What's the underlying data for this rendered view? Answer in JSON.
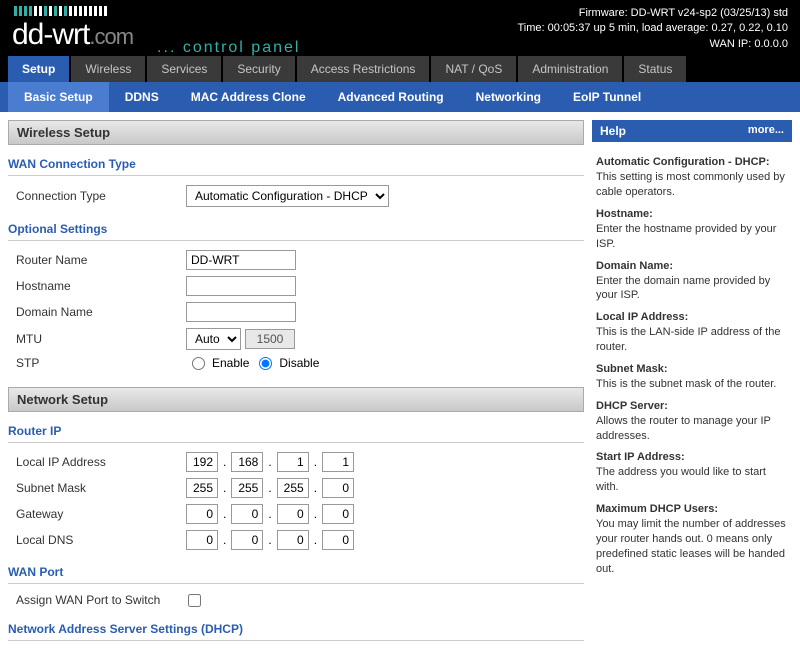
{
  "status": {
    "firmware": "Firmware: DD-WRT v24-sp2 (03/25/13) std",
    "time": "Time: 00:05:37 up 5 min, load average: 0.27, 0.22, 0.10",
    "wan": "WAN IP: 0.0.0.0"
  },
  "cp": "... control panel",
  "mainTabs": [
    "Setup",
    "Wireless",
    "Services",
    "Security",
    "Access Restrictions",
    "NAT / QoS",
    "Administration",
    "Status"
  ],
  "subTabs": [
    "Basic Setup",
    "DDNS",
    "MAC Address Clone",
    "Advanced Routing",
    "Networking",
    "EoIP Tunnel"
  ],
  "sections": {
    "wireless": "Wireless Setup",
    "network": "Network Setup"
  },
  "groups": {
    "wanType": "WAN Connection Type",
    "optional": "Optional Settings",
    "routerIp": "Router IP",
    "wanPort": "WAN Port",
    "dhcp": "Network Address Server Settings (DHCP)"
  },
  "labels": {
    "connType": "Connection Type",
    "routerName": "Router Name",
    "hostname": "Hostname",
    "domainName": "Domain Name",
    "mtu": "MTU",
    "stp": "STP",
    "enable": "Enable",
    "disable": "Disable",
    "localIp": "Local IP Address",
    "subnet": "Subnet Mask",
    "gateway": "Gateway",
    "localDns": "Local DNS",
    "assignWan": "Assign WAN Port to Switch"
  },
  "values": {
    "connType": "Automatic Configuration - DHCP",
    "routerName": "DD-WRT",
    "hostname": "",
    "domainName": "",
    "mtuMode": "Auto",
    "mtuVal": "1500",
    "localIp": [
      "192",
      "168",
      "1",
      "1"
    ],
    "subnet": [
      "255",
      "255",
      "255",
      "0"
    ],
    "gateway": [
      "0",
      "0",
      "0",
      "0"
    ],
    "localDns": [
      "0",
      "0",
      "0",
      "0"
    ]
  },
  "help": {
    "title": "Help",
    "more": "more...",
    "items": [
      {
        "t": "Automatic Configuration - DHCP:",
        "d": "This setting is most commonly used by cable operators."
      },
      {
        "t": "Hostname:",
        "d": "Enter the hostname provided by your ISP."
      },
      {
        "t": "Domain Name:",
        "d": "Enter the domain name provided by your ISP."
      },
      {
        "t": "Local IP Address:",
        "d": "This is the LAN-side IP address of the router."
      },
      {
        "t": "Subnet Mask:",
        "d": "This is the subnet mask of the router."
      },
      {
        "t": "DHCP Server:",
        "d": "Allows the router to manage your IP addresses."
      },
      {
        "t": "Start IP Address:",
        "d": "The address you would like to start with."
      },
      {
        "t": "Maximum DHCP Users:",
        "d": "You may limit the number of addresses your router hands out. 0 means only predefined static leases will be handed out."
      }
    ]
  }
}
